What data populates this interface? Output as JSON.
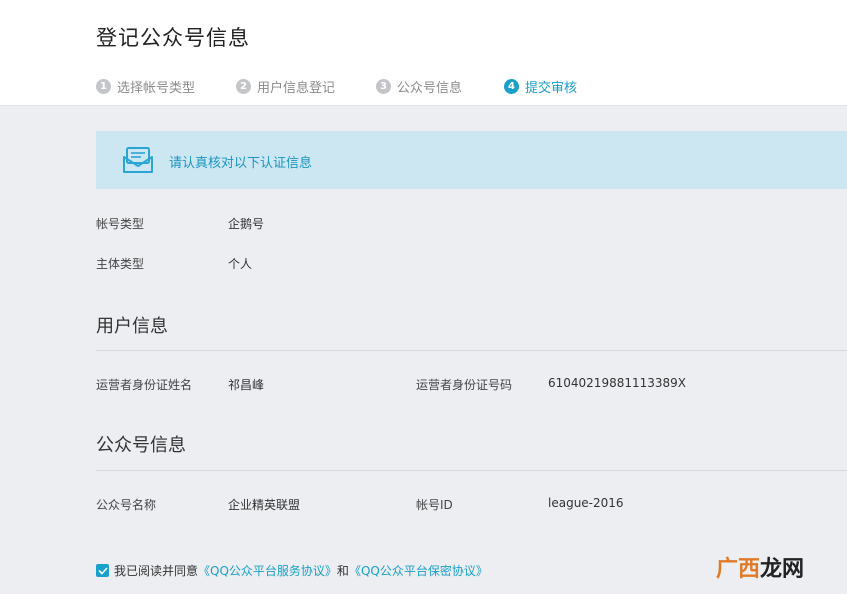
{
  "header": {
    "title": "登记公众号信息",
    "steps": [
      {
        "num": "1",
        "label": "选择帐号类型"
      },
      {
        "num": "2",
        "label": "用户信息登记"
      },
      {
        "num": "3",
        "label": "公众号信息"
      },
      {
        "num": "4",
        "label": "提交审核"
      }
    ],
    "active_step": 4
  },
  "notice": {
    "icon": "envelope-icon",
    "text": "请认真核对以下认证信息"
  },
  "account": {
    "type_label": "帐号类型",
    "type_value": "企鹅号",
    "subject_label": "主体类型",
    "subject_value": "个人"
  },
  "user_info": {
    "section_title": "用户信息",
    "name_label": "运营者身份证姓名",
    "name_value": "祁昌峰",
    "id_label": "运营者身份证号码",
    "id_value": "61040219881113389X"
  },
  "official_info": {
    "section_title": "公众号信息",
    "name_label": "公众号名称",
    "name_value": "企业精英联盟",
    "account_id_label": "帐号ID",
    "account_id_value": "league-2016"
  },
  "agreement": {
    "checked": true,
    "prefix": "我已阅读并同意",
    "link1": "《QQ公众平台服务协议》",
    "middle": "和",
    "link2": "《QQ公众平台保密协议》"
  },
  "watermark": {
    "part1": "广西",
    "part2": "龙网"
  },
  "colors": {
    "accent": "#1aa0c9",
    "notice_bg": "#cde7f2",
    "page_bg": "#eceef2"
  }
}
